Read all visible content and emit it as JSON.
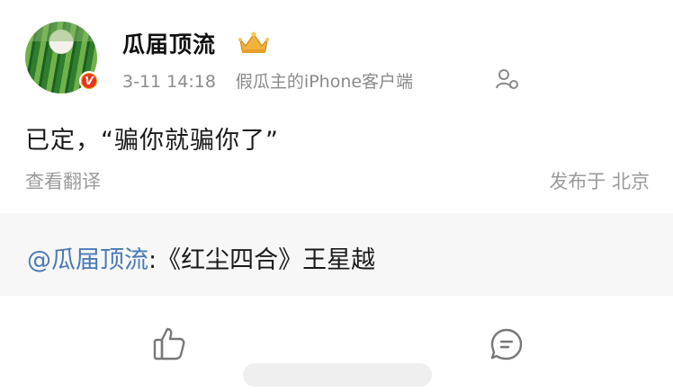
{
  "post": {
    "username": "瓜届顶流",
    "badge_letter": "V",
    "timestamp": "3-11 14:18",
    "source": "假瓜主的iPhone客户端",
    "content": "已定，“骗你就骗你了”",
    "translate_label": "查看翻译",
    "location": "发布于 北京"
  },
  "repost": {
    "mention": "@瓜届顶流",
    "text": ":《红尘四合》王星越"
  },
  "icons": {
    "crown": "crown-icon",
    "follow": "add-person-icon",
    "like": "thumbs-up-icon",
    "comment": "comment-icon"
  },
  "colors": {
    "mention": "#4a7ab8",
    "verified_badge": "#e8341f",
    "crown": "#f2b33d"
  }
}
